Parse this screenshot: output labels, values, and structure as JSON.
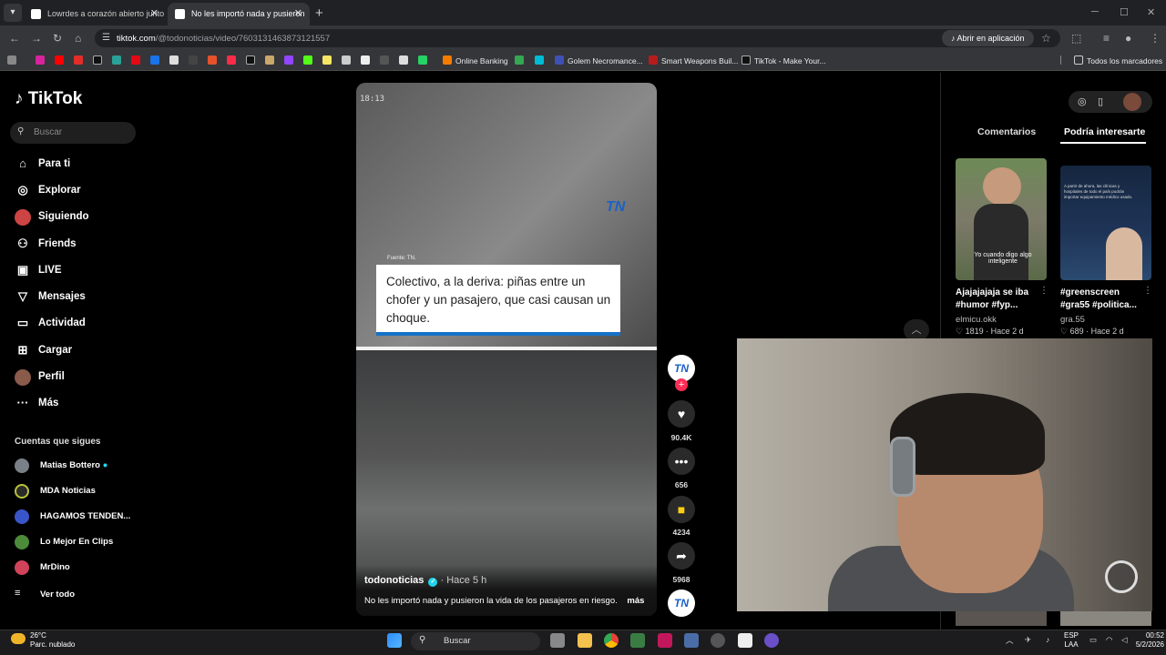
{
  "browser": {
    "tabs": [
      {
        "title": "Lowrdes a corazón abierto junto",
        "active": false
      },
      {
        "title": "No les importó nada y pusieron",
        "active": true
      }
    ],
    "url_host": "tiktok.com",
    "url_path": "/@todonoticias/video/7603131463873121557",
    "open_app_label": "Abrir en aplicación",
    "bookmarks": [
      "Online Banking",
      "Golem Necromance...",
      "Smart Weapons Buil...",
      "TikTok - Make Your..."
    ],
    "all_bookmarks": "Todos los marcadores"
  },
  "sidebar": {
    "logo": "TikTok",
    "search_placeholder": "Buscar",
    "nav": [
      {
        "label": "Para ti",
        "icon": "home-icon"
      },
      {
        "label": "Explorar",
        "icon": "compass-icon"
      },
      {
        "label": "Siguiendo",
        "icon": "following-icon"
      },
      {
        "label": "Friends",
        "icon": "friends-icon"
      },
      {
        "label": "LIVE",
        "icon": "live-icon"
      },
      {
        "label": "Mensajes",
        "icon": "send-icon"
      },
      {
        "label": "Actividad",
        "icon": "activity-icon"
      },
      {
        "label": "Cargar",
        "icon": "upload-icon"
      },
      {
        "label": "Perfil",
        "icon": "profile-icon"
      },
      {
        "label": "Más",
        "icon": "more-icon"
      }
    ],
    "following_title": "Cuentas que sigues",
    "following": [
      "Matias Bottero",
      "MDA Noticias",
      "HAGAMOS TENDEN...",
      "Lo Mejor En Clips",
      "MrDino",
      "Ver todo"
    ]
  },
  "video": {
    "timestamp": "18:13",
    "channel_logo": "TN",
    "source_label": "Fuente: TN.",
    "caption": "Colectivo, a la deriva: piñas entre un chofer y un pasajero, que casi causan un choque.",
    "author": "todonoticias",
    "verified": "✓",
    "posted": "· Hace 5 h",
    "description": "No les importó nada y pusieron la vida de los pasajeros en riesgo.",
    "more_label": "más"
  },
  "actions": {
    "avatar_text": "TN",
    "likes": "90.4K",
    "comments": "656",
    "saves": "4234",
    "shares": "5968"
  },
  "right_panel": {
    "tab_comments": "Comentarios",
    "tab_suggested": "Podría interesarte",
    "cards": [
      {
        "title": "Ajajajajaja se iba #humor #fyp...",
        "user": "elmicu.okk",
        "likes": "1819",
        "age": "Hace 2 d",
        "overlay": "Yo cuando digo algo inteligente"
      },
      {
        "title": "#greenscreen #gra55 #politica...",
        "user": "gra.55",
        "likes": "689",
        "age": "Hace 2 d",
        "overlay": "A partir de ahora, las clínicas y hospitales de todo el país podrán importar equipamiento médico usado."
      }
    ]
  },
  "taskbar": {
    "temp": "26°C",
    "weather": "Parc. nublado",
    "search": "Buscar",
    "lang_top": "ESP",
    "lang_bottom": "LAA",
    "time": "00:52",
    "date": "5/2/2026"
  },
  "colors": {
    "accent": "#fe2c55",
    "tn_blue": "#1572c8",
    "verified": "#20d5ec"
  }
}
